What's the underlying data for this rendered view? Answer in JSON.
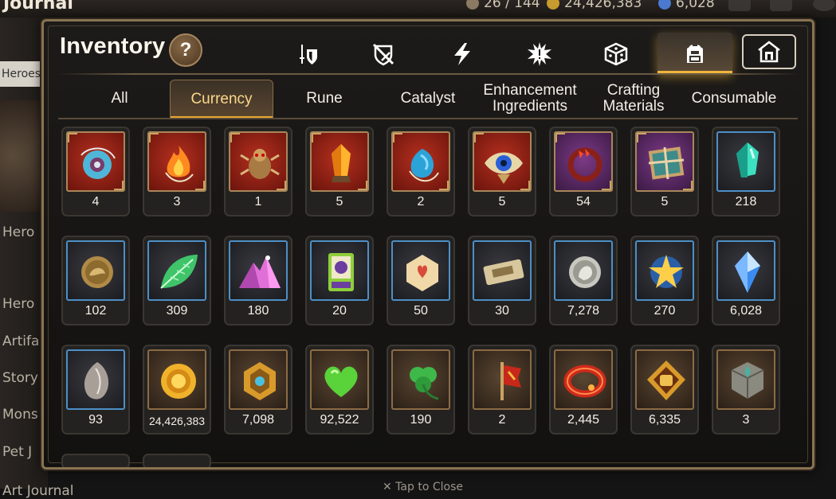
{
  "background": {
    "title": "Journal",
    "resources": [
      "26 / 144",
      "24,426,383",
      "6,028"
    ],
    "heroes_tag": "Heroes",
    "sidebar": [
      "Hero",
      "Artifa",
      "Story",
      "Mons",
      "Pet J",
      "Art Journal"
    ],
    "hint": "✕ Tap to Close"
  },
  "inventory": {
    "title": "Inventory",
    "help_label": "?",
    "category_icons": [
      "sword-shield-icon",
      "crossed-sword-shield-icon",
      "lightning-icon",
      "spiky-burst-icon",
      "dice-icon",
      "backpack-icon",
      "house-icon"
    ],
    "active_category": "backpack-icon",
    "sub_tabs": [
      "All",
      "Currency",
      "Rune",
      "Catalyst",
      "Enhancement\nIngredients",
      "Crafting\nMaterials",
      "Consumable"
    ],
    "active_sub_tab": "Currency",
    "items": [
      {
        "icon": "cyan-amulet-icon",
        "count": "4",
        "frame": "red"
      },
      {
        "icon": "flame-amulet-icon",
        "count": "3",
        "frame": "red"
      },
      {
        "icon": "beetle-icon",
        "count": "1",
        "frame": "red"
      },
      {
        "icon": "amber-crystal-icon",
        "count": "5",
        "frame": "red"
      },
      {
        "icon": "blue-amulet-icon",
        "count": "2",
        "frame": "red"
      },
      {
        "icon": "eye-emblem-icon",
        "count": "5",
        "frame": "red"
      },
      {
        "icon": "crimson-bracelet-icon",
        "count": "54",
        "frame": "purple"
      },
      {
        "icon": "map-bundle-icon",
        "count": "5",
        "frame": "purple"
      },
      {
        "icon": "teal-crystal-icon",
        "count": "218",
        "frame": "blue"
      },
      {
        "icon": "bronze-coin-icon",
        "count": "102",
        "frame": "blue"
      },
      {
        "icon": "leaf-icon",
        "count": "309",
        "frame": "blue"
      },
      {
        "icon": "pink-crystal-pile-icon",
        "count": "180",
        "frame": "blue"
      },
      {
        "icon": "card-icon",
        "count": "20",
        "frame": "blue"
      },
      {
        "icon": "scroll-heart-icon",
        "count": "50",
        "frame": "blue"
      },
      {
        "icon": "ticket-icon",
        "count": "30",
        "frame": "blue"
      },
      {
        "icon": "silver-coin-icon",
        "count": "7,278",
        "frame": "blue"
      },
      {
        "icon": "star-amulet-icon",
        "count": "270",
        "frame": "blue"
      },
      {
        "icon": "sky-gem-icon",
        "count": "6,028",
        "frame": "blue"
      },
      {
        "icon": "seed-icon",
        "count": "93",
        "frame": "blue"
      },
      {
        "icon": "gold-sun-coin-icon",
        "count": "24,426,383",
        "frame": "brown"
      },
      {
        "icon": "hexagon-emblem-icon",
        "count": "7,098",
        "frame": "brown"
      },
      {
        "icon": "green-heart-icon",
        "count": "92,522",
        "frame": "brown"
      },
      {
        "icon": "clover-icon",
        "count": "190",
        "frame": "brown"
      },
      {
        "icon": "red-banner-icon",
        "count": "2",
        "frame": "brown"
      },
      {
        "icon": "red-ring-icon",
        "count": "2,445",
        "frame": "brown"
      },
      {
        "icon": "fist-emblem-icon",
        "count": "6,335",
        "frame": "brown"
      },
      {
        "icon": "stone-cube-icon",
        "count": "3",
        "frame": "brown"
      }
    ]
  },
  "colors": {
    "accent": "#f0b53a",
    "frame_blue": "#4d8fc6",
    "frame_gold": "#a8865a"
  }
}
